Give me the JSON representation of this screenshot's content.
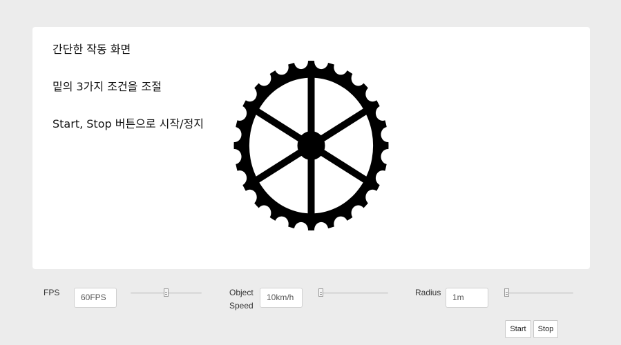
{
  "instructions": [
    "간단한 작동 화면",
    "밑의 3가지 조건을 조절",
    "Start, Stop 버튼으로 시작/정지"
  ],
  "wheel": {
    "icon": "gear-wheel-icon",
    "color": "#000000",
    "spokes": 6,
    "teeth": 24
  },
  "controls": {
    "fps": {
      "label": "FPS",
      "value": "60FPS",
      "slider_level": 0.5
    },
    "speed": {
      "label_line1": "Object",
      "label_line2": "Speed",
      "value": "10km/h",
      "slider_level": 0.0
    },
    "radius": {
      "label": "Radius",
      "value": "1m",
      "slider_level": 0.0
    }
  },
  "buttons": {
    "start": "Start",
    "stop": "Stop"
  }
}
